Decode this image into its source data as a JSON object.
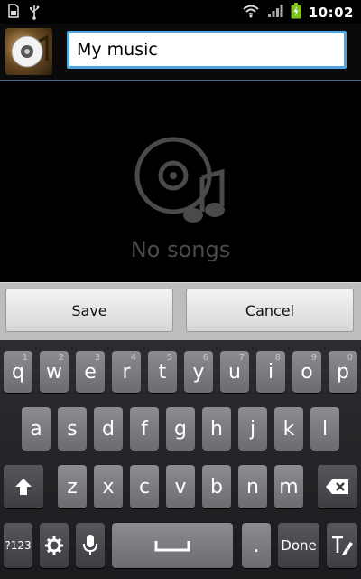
{
  "status_bar": {
    "time": "10:02",
    "icons": [
      "sd-card-icon",
      "usb-icon",
      "wifi-icon",
      "signal-icon",
      "battery-charging-icon"
    ]
  },
  "header": {
    "playlist_name_value": "My music"
  },
  "empty_state": {
    "message": "No songs",
    "icon": "music-disc-icon"
  },
  "buttons": {
    "save_label": "Save",
    "cancel_label": "Cancel"
  },
  "keyboard": {
    "row1": [
      {
        "key": "q",
        "hint": "1"
      },
      {
        "key": "w",
        "hint": "2"
      },
      {
        "key": "e",
        "hint": "3"
      },
      {
        "key": "r",
        "hint": "4"
      },
      {
        "key": "t",
        "hint": "5"
      },
      {
        "key": "y",
        "hint": "6"
      },
      {
        "key": "u",
        "hint": "7"
      },
      {
        "key": "i",
        "hint": "8"
      },
      {
        "key": "o",
        "hint": "9"
      },
      {
        "key": "p",
        "hint": "0"
      }
    ],
    "row2": [
      "a",
      "s",
      "d",
      "f",
      "g",
      "h",
      "j",
      "k",
      "l"
    ],
    "row3": [
      "z",
      "x",
      "c",
      "v",
      "b",
      "n",
      "m"
    ],
    "symbols_label": "?123",
    "period_label": ".",
    "done_label": "Done"
  },
  "colors": {
    "input_border": "#4fa3e0",
    "header_divider": "#5b6f86",
    "key_face": "#7a7c80",
    "empty_text": "#4a4a4a"
  }
}
